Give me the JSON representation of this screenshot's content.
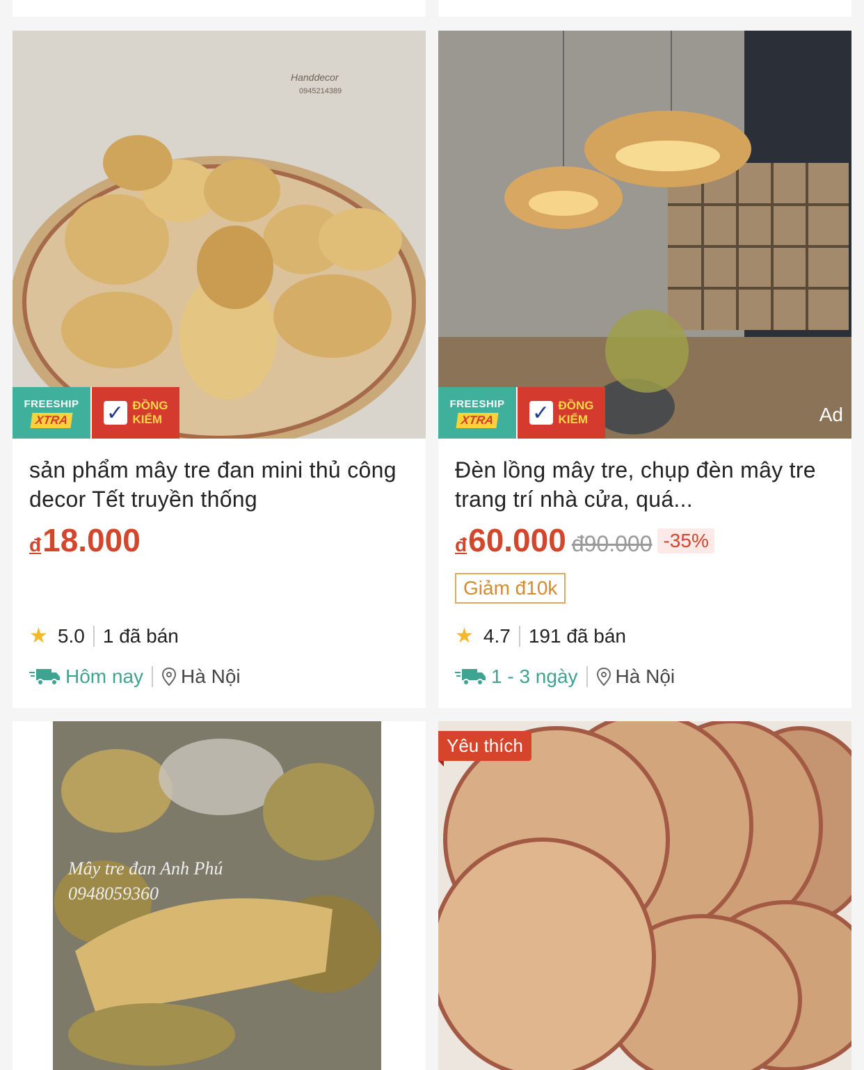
{
  "products": [
    {
      "title": "sản phẩm mây tre đan mini thủ công decor Tết truyền thống",
      "price_currency": "đ",
      "price": "18.000",
      "rating": "5.0",
      "sold": "1 đã bán",
      "shipping": "Hôm nay",
      "location": "Hà Nội",
      "badge_freeship": "FREESHIP",
      "badge_xtra": "XTRA",
      "badge_dongkiem_1": "ĐỒNG",
      "badge_dongkiem_2": "KIỂM",
      "image_watermark_1": "Handdecor",
      "image_watermark_2": "0945214389"
    },
    {
      "title": "Đèn lồng mây tre, chụp đèn mây tre trang trí nhà cửa, quá...",
      "price_currency": "đ",
      "price": "60.000",
      "old_price": "đ90.000",
      "discount": "-35%",
      "voucher": "Giảm đ10k",
      "rating": "4.7",
      "sold": "191 đã bán",
      "shipping": "1 - 3 ngày",
      "location": "Hà Nội",
      "badge_freeship": "FREESHIP",
      "badge_xtra": "XTRA",
      "badge_dongkiem_1": "ĐỒNG",
      "badge_dongkiem_2": "KIỂM",
      "ad_label": "Ad"
    },
    {
      "image_watermark_1": "Mây tre đan Anh Phú",
      "image_watermark_2": "0948059360"
    },
    {
      "favorite_label": "Yêu thích"
    }
  ],
  "colors": {
    "price": "#d2462b",
    "freeship": "#3fb09b",
    "dongkiem": "#d43a2e",
    "shipping": "#3fa391",
    "star": "#f6b82b"
  },
  "icons": [
    "star-icon",
    "truck-icon",
    "location-pin-icon",
    "check-icon"
  ]
}
